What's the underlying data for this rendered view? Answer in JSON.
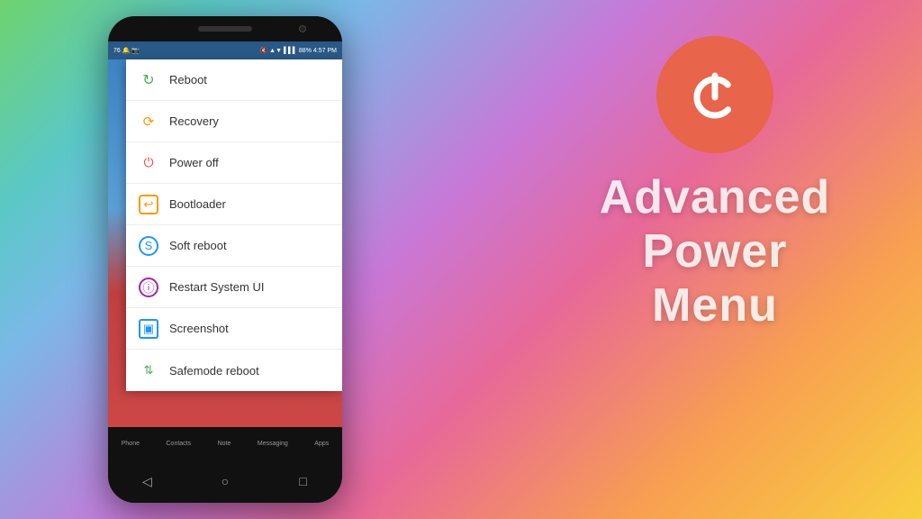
{
  "background": {
    "gradient": "colorful gradient green to pink to orange"
  },
  "phone": {
    "status_bar": {
      "left_icons": "76 icons",
      "time": "4:57 PM",
      "battery": "88%",
      "signal": "indicators"
    },
    "menu": {
      "items": [
        {
          "label": "Reboot",
          "icon": "↻",
          "color": "#4caf50"
        },
        {
          "label": "Recovery",
          "icon": "⟳",
          "color": "#ff9800"
        },
        {
          "label": "Power off",
          "icon": "⏻",
          "color": "#f44336"
        },
        {
          "label": "Bootloader",
          "icon": "➤",
          "color": "#ff9800"
        },
        {
          "label": "Soft reboot",
          "icon": "S",
          "color": "#2196f3"
        },
        {
          "label": "Restart System UI",
          "icon": "ℹ",
          "color": "#9c27b0"
        },
        {
          "label": "Screenshot",
          "icon": "▣",
          "color": "#2196f3"
        },
        {
          "label": "Safemode reboot",
          "icon": "⇅",
          "color": "#4caf50"
        }
      ]
    },
    "app_bar": {
      "items": [
        "Phone",
        "Contacts",
        "Note",
        "Messaging",
        "Apps"
      ]
    },
    "nav": {
      "back": "◁",
      "home": "○",
      "recent": "□"
    }
  },
  "right_panel": {
    "title_line1": "Advanced",
    "title_line2": "Power",
    "title_line3": "Menu"
  }
}
